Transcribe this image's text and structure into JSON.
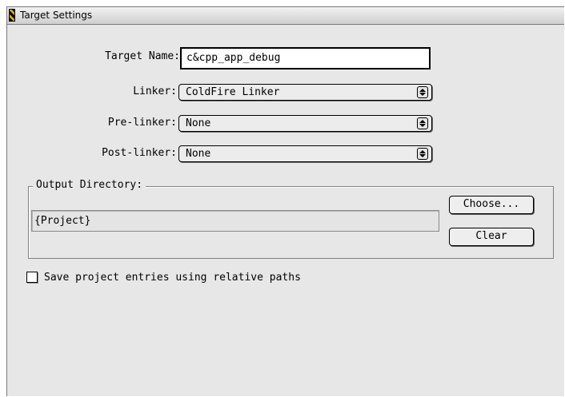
{
  "window": {
    "title": "Target Settings"
  },
  "form": {
    "target_name": {
      "label": "Target Name:",
      "value": "c&cpp_app_debug"
    },
    "linker": {
      "label": "Linker:",
      "value": "ColdFire Linker"
    },
    "pre_linker": {
      "label": "Pre-linker:",
      "value": "None"
    },
    "post_linker": {
      "label": "Post-linker:",
      "value": "None"
    }
  },
  "output_directory": {
    "label": "Output Directory:",
    "path": "{Project}",
    "choose_label": "Choose...",
    "clear_label": "Clear"
  },
  "relative_paths": {
    "label": "Save project entries using relative paths",
    "checked": false
  }
}
